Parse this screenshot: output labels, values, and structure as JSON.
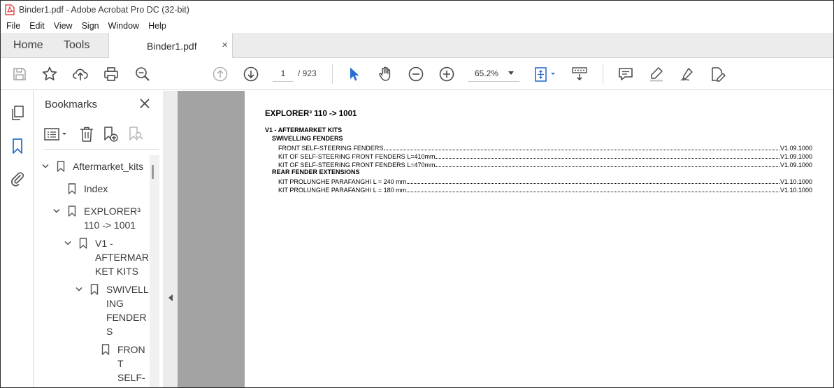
{
  "window": {
    "title": "Binder1.pdf - Adobe Acrobat Pro DC (32-bit)"
  },
  "menu": [
    "File",
    "Edit",
    "View",
    "Sign",
    "Window",
    "Help"
  ],
  "tabs": {
    "home": "Home",
    "tools": "Tools",
    "document": "Binder1.pdf",
    "close_symbol": "×"
  },
  "toolbar": {
    "page_current": "1",
    "page_total": "/ 923",
    "zoom": "65.2%"
  },
  "bookmarks": {
    "header": "Bookmarks",
    "items": [
      {
        "label": "Aftermarket_kits"
      },
      {
        "label": "Index"
      },
      {
        "line1": "EXPLORER³",
        "line2": "110 -> 1001"
      },
      {
        "line1": "V1 -",
        "line2": "AFTERMAR",
        "line3": "KET KITS"
      },
      {
        "line1": "SWIVELL",
        "line2": "ING",
        "line3": "FENDER",
        "line4": "S"
      },
      {
        "line1": "FRON",
        "line2": "T",
        "line3": "SELF-"
      }
    ]
  },
  "document": {
    "title": "EXPLORER³ 110 -> 1001",
    "section": "V1 - AFTERMARKET KITS",
    "groups": [
      {
        "heading": "SWIVELLING FENDERS",
        "entries": [
          {
            "text": "FRONT SELF-STEERING FENDERS",
            "page": "V1.09.1000"
          },
          {
            "text": "KIT OF SELF-STEERING FRONT FENDERS L=410mm",
            "page": "V1.09.1000"
          },
          {
            "text": "KIT OF SELF-STEERING FRONT FENDERS L=470mm",
            "page": "V1.09.1000"
          }
        ]
      },
      {
        "heading": "REAR FENDER EXTENSIONS",
        "entries": [
          {
            "text": "KIT PROLUNGHE PARAFANGHI L = 240 mm",
            "page": "V1.10.1000"
          },
          {
            "text": "KIT PROLUNGHE PARAFANGHI L = 180 mm",
            "page": "V1.10.1000"
          }
        ]
      }
    ]
  },
  "colors": {
    "accent_blue": "#2a6fce",
    "pdf_red": "#d9232d",
    "doc_background": "#a3a3a3"
  }
}
